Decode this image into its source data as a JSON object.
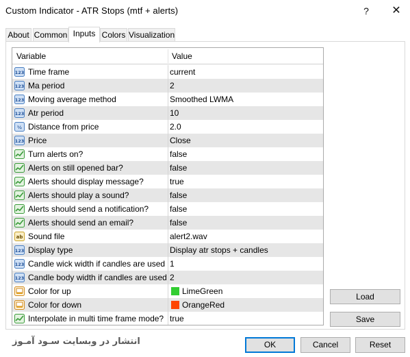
{
  "window": {
    "title": "Custom Indicator - ATR Stops (mtf + alerts)",
    "help_glyph": "?",
    "close_glyph": "✕"
  },
  "tabs": [
    {
      "label": "About"
    },
    {
      "label": "Common"
    },
    {
      "label": "Inputs"
    },
    {
      "label": "Colors"
    },
    {
      "label": "Visualization"
    }
  ],
  "grid": {
    "headers": {
      "variable": "Variable",
      "value": "Value"
    },
    "rows": [
      {
        "icon": "int-icon",
        "name": "Time frame",
        "value": "current"
      },
      {
        "icon": "int-icon",
        "name": "Ma period",
        "value": "2"
      },
      {
        "icon": "int-icon",
        "name": "Moving average method",
        "value": "Smoothed LWMA"
      },
      {
        "icon": "int-icon",
        "name": "Atr period",
        "value": "10"
      },
      {
        "icon": "double-icon",
        "name": "Distance from price",
        "value": "2.0"
      },
      {
        "icon": "int-icon",
        "name": "Price",
        "value": "Close"
      },
      {
        "icon": "bool-icon",
        "name": "Turn alerts on?",
        "value": "false"
      },
      {
        "icon": "bool-icon",
        "name": "Alerts on still opened bar?",
        "value": "false"
      },
      {
        "icon": "bool-icon",
        "name": "Alerts should display message?",
        "value": "true"
      },
      {
        "icon": "bool-icon",
        "name": "Alerts should play a sound?",
        "value": "false"
      },
      {
        "icon": "bool-icon",
        "name": "Alerts should send a notification?",
        "value": "false"
      },
      {
        "icon": "bool-icon",
        "name": "Alerts should send an email?",
        "value": "false"
      },
      {
        "icon": "string-icon",
        "name": "Sound file",
        "value": "alert2.wav"
      },
      {
        "icon": "int-icon",
        "name": "Display type",
        "value": "Display atr stops + candles"
      },
      {
        "icon": "int-icon",
        "name": "Candle wick width if candles are used",
        "value": "1"
      },
      {
        "icon": "int-icon",
        "name": "Candle body width if candles are used",
        "value": "2"
      },
      {
        "icon": "color-icon",
        "name": "Color for up",
        "value": "LimeGreen",
        "swatch": "#32cd32"
      },
      {
        "icon": "color-icon",
        "name": "Color for down",
        "value": "OrangeRed",
        "swatch": "#ff4500"
      },
      {
        "icon": "bool-icon",
        "name": "Interpolate in multi time frame mode?",
        "value": "true"
      }
    ]
  },
  "buttons": {
    "load": "Load",
    "save": "Save",
    "ok": "OK",
    "cancel": "Cancel",
    "reset": "Reset"
  },
  "watermark": "انتشار در وبسایت سـود آمـوز",
  "colors": {
    "alt_row": "#e6e6e6",
    "ok_border": "#0078d7",
    "icon_blue": "#4a7fc1",
    "icon_green": "#3a9a3a"
  }
}
